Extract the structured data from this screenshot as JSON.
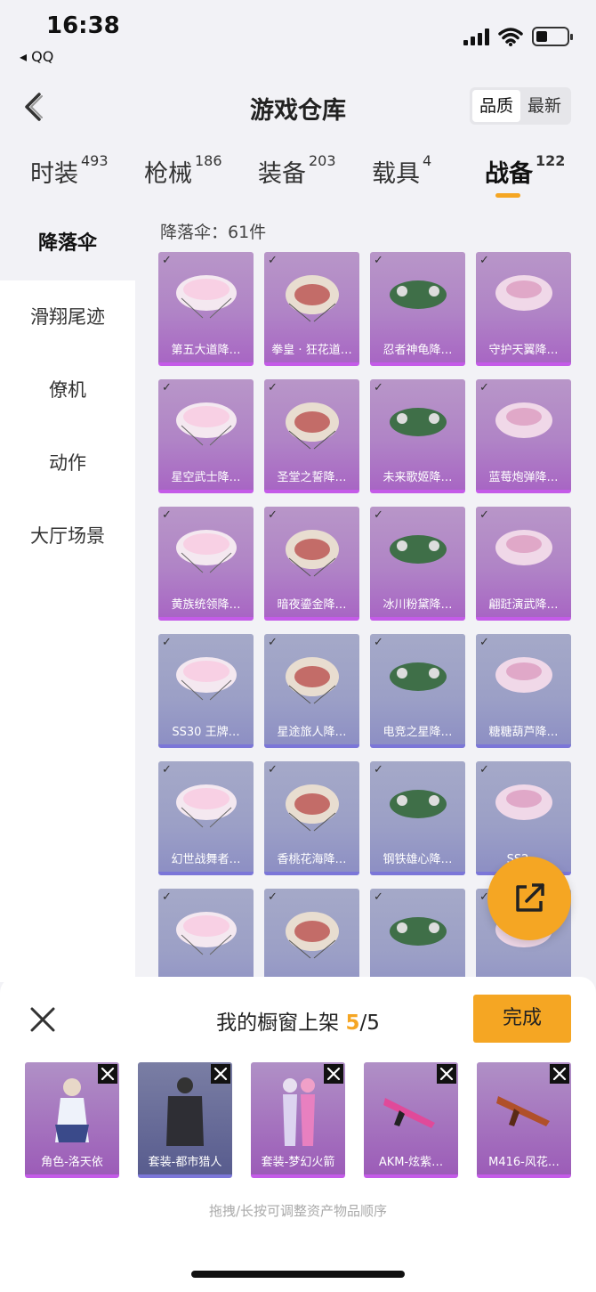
{
  "status": {
    "time": "16:38",
    "back_app": "◂ QQ"
  },
  "nav": {
    "title": "游戏仓库",
    "sort_quality": "品质",
    "sort_newest": "最新"
  },
  "tabs": [
    {
      "label": "时装",
      "count": "493"
    },
    {
      "label": "枪械",
      "count": "186"
    },
    {
      "label": "装备",
      "count": "203"
    },
    {
      "label": "载具",
      "count": "4"
    },
    {
      "label": "战备",
      "count": "122"
    }
  ],
  "sidebar": [
    "降落伞",
    "滑翔尾迹",
    "僚机",
    "动作",
    "大厅场景"
  ],
  "grid": {
    "count_label": "降落伞：61件",
    "items": [
      {
        "name": "第五大道降…",
        "rarity": "purple"
      },
      {
        "name": "拳皇 · 狂花道…",
        "rarity": "purple"
      },
      {
        "name": "忍者神龟降…",
        "rarity": "purple"
      },
      {
        "name": "守护天翼降…",
        "rarity": "purple"
      },
      {
        "name": "星空武士降…",
        "rarity": "purple"
      },
      {
        "name": "圣堂之誓降…",
        "rarity": "purple"
      },
      {
        "name": "未来歌姬降…",
        "rarity": "purple"
      },
      {
        "name": "蓝莓炮弹降…",
        "rarity": "purple"
      },
      {
        "name": "黄族统领降…",
        "rarity": "purple"
      },
      {
        "name": "暗夜鎏金降…",
        "rarity": "purple"
      },
      {
        "name": "冰川粉黛降…",
        "rarity": "purple"
      },
      {
        "name": "翩跹演武降…",
        "rarity": "purple"
      },
      {
        "name": "SS30 王牌…",
        "rarity": "blue"
      },
      {
        "name": "星途旅人降…",
        "rarity": "blue"
      },
      {
        "name": "电竞之星降…",
        "rarity": "blue"
      },
      {
        "name": "糖糖葫芦降…",
        "rarity": "blue"
      },
      {
        "name": "幻世战舞者…",
        "rarity": "blue"
      },
      {
        "name": "香桃花海降…",
        "rarity": "blue"
      },
      {
        "name": "钢铁雄心降…",
        "rarity": "blue"
      },
      {
        "name": "SS2…",
        "rarity": "blue"
      },
      {
        "name": "",
        "rarity": "blue"
      },
      {
        "name": "",
        "rarity": "blue"
      },
      {
        "name": "",
        "rarity": "blue"
      },
      {
        "name": "",
        "rarity": "blue"
      }
    ]
  },
  "sheet": {
    "title_prefix": "我的橱窗上架 ",
    "title_count": "5",
    "title_total": "/5",
    "done_label": "完成",
    "items": [
      {
        "label": "角色-洛天依",
        "rarity": "purple"
      },
      {
        "label": "套装-都市猎人",
        "rarity": "blue"
      },
      {
        "label": "套装-梦幻火箭",
        "rarity": "purple"
      },
      {
        "label": "AKM-炫紫…",
        "rarity": "purple"
      },
      {
        "label": "M416-风花…",
        "rarity": "purple"
      }
    ],
    "hint": "拖拽/长按可调整资产物品顺序"
  },
  "colors": {
    "accent": "#f5a623",
    "purple_rarity": "#c45be8",
    "blue_rarity": "#7b76d8"
  }
}
